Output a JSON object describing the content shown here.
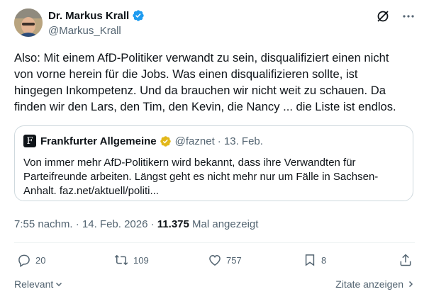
{
  "author": {
    "display_name": "Dr. Markus Krall",
    "handle": "@Markus_Krall"
  },
  "tweet": {
    "text": "Also: Mit einem AfD-Politiker verwandt zu sein, disqualifiziert einen nicht\nvon vorne herein für die Jobs. Was einen disqualifizieren sollte, ist\nhingegen Inkompetenz. Und da brauchen wir nicht weit zu schauen. Da\nfinden wir den Lars, den Tim, den Kevin, die Nancy ... die Liste ist endlos."
  },
  "quote": {
    "logo_letter": "F",
    "name": "Frankfurter Allgemeine",
    "handle": "@faznet",
    "date": "· 13. Feb.",
    "text": "Von immer mehr AfD-Politikern wird bekannt, dass ihre Verwandten für\nParteifreunde arbeiten. Längst geht es nicht mehr nur um Fälle in Sachsen-\nAnhalt. faz.net/aktuell/politi..."
  },
  "meta": {
    "timestamp": "7:55 nachm. · 14. Feb. 2026 ·",
    "views": "11.375",
    "views_label": "Mal angezeigt"
  },
  "actions": {
    "replies": "20",
    "reposts": "109",
    "likes": "757",
    "bookmarks": "8"
  },
  "footer": {
    "sort_label": "Relevant",
    "quotes_label": "Zitate anzeigen"
  },
  "colors": {
    "text": "#0f1419",
    "secondary": "#536471",
    "verified_blue": "#1d9bf0",
    "verified_gold": "#e2b719",
    "border": "#cfd9de"
  },
  "icons": {
    "verified": "verified-badge-icon",
    "grok": "grok-icon",
    "more": "more-icon",
    "reply": "reply-icon",
    "repost": "repost-icon",
    "like": "like-icon",
    "bookmark": "bookmark-icon",
    "share": "share-icon"
  }
}
